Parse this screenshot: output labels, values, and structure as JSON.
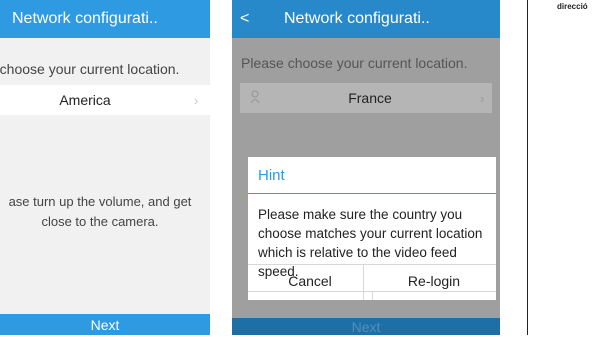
{
  "left_screen": {
    "title": "Network configurati..",
    "prompt": "e choose your current location.",
    "location": "America",
    "volume_line1": "ase turn up the volume, and get",
    "volume_line2": "close to the camera.",
    "next_label": "Next"
  },
  "middle_screen": {
    "title": "Network configurati..",
    "back_icon": "<",
    "prompt": "Please choose your current location.",
    "location": "France",
    "next_label": "Next",
    "dialog": {
      "title": "Hint",
      "message": "Please make sure the country you choose matches your current location which is relative to the video feed speed.",
      "cancel_label": "Cancel",
      "relogin_label": "Re-login"
    }
  },
  "right_panel": {
    "label": "direcció"
  },
  "colors": {
    "accent": "#2d9ae2",
    "overlay_accent": "#2789c9"
  }
}
